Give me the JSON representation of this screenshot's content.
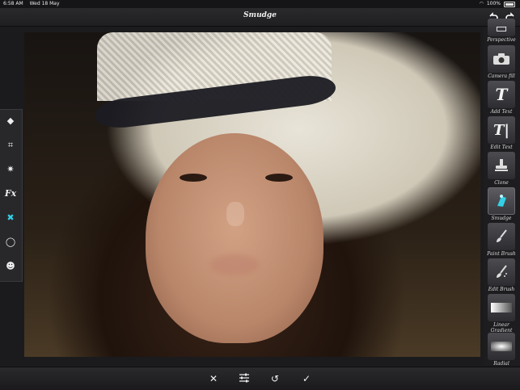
{
  "status_bar": {
    "time": "6:58 AM",
    "date": "Wed 18 May",
    "battery": "100%"
  },
  "header": {
    "title": "Smudge",
    "left_icon": "undo-icon",
    "right_icon": "redo-icon"
  },
  "left_toolbar": {
    "items": [
      {
        "icon": "layers-icon"
      },
      {
        "icon": "camera-adjust-icon"
      },
      {
        "icon": "brightness-icon"
      },
      {
        "icon": "fx-icon",
        "label": "Fx"
      },
      {
        "icon": "retouch-tool-icon"
      },
      {
        "icon": "vignette-icon"
      },
      {
        "icon": "mask-icon"
      }
    ]
  },
  "right_panel": {
    "items": [
      {
        "label": "Perspective",
        "icon": "perspective-icon"
      },
      {
        "label": "Camera fill",
        "icon": "camera-fill-icon"
      },
      {
        "label": "Add Text",
        "icon": "add-text-icon",
        "glyph": "T"
      },
      {
        "label": "Edit Text",
        "icon": "edit-text-icon",
        "glyph": "T|"
      },
      {
        "label": "Clone",
        "icon": "clone-stamp-icon"
      },
      {
        "label": "Smudge",
        "icon": "smudge-icon"
      },
      {
        "label": "Paint Brush",
        "icon": "paint-brush-icon"
      },
      {
        "label": "Edit Brush",
        "icon": "edit-brush-icon"
      },
      {
        "label": "Linear Gradient",
        "icon": "linear-gradient-icon"
      },
      {
        "label": "Radial Gradient",
        "icon": "radial-gradient-icon"
      }
    ],
    "selected": "Smudge"
  },
  "bottom_bar": {
    "buttons": [
      {
        "icon": "close-icon"
      },
      {
        "icon": "sliders-icon"
      },
      {
        "icon": "reset-icon"
      },
      {
        "icon": "check-icon"
      }
    ]
  },
  "colors": {
    "accent": "#33d0e6",
    "toolbar_bg": "#1f1f22"
  }
}
